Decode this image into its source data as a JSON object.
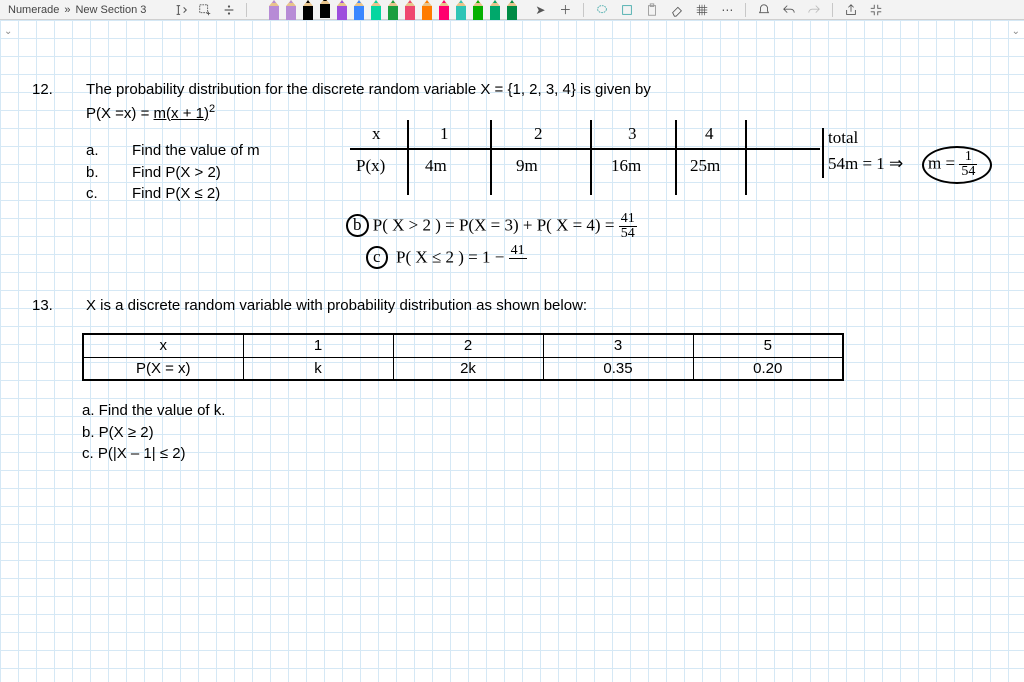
{
  "breadcrumb": {
    "app": "Numerade",
    "sep": "»",
    "section": "New Section 3"
  },
  "pens": [
    {
      "color": "#b78bd6"
    },
    {
      "color": "#b78bd6"
    },
    {
      "color": "#000000"
    },
    {
      "color": "#000000",
      "selected": true
    },
    {
      "color": "#9d4edd"
    },
    {
      "color": "#3a86ff"
    },
    {
      "color": "#06d6a0"
    },
    {
      "color": "#1b9e3f"
    },
    {
      "color": "#ef476f"
    },
    {
      "color": "#ff7b00"
    },
    {
      "color": "#ff006e"
    },
    {
      "color": "#2ec4b6"
    },
    {
      "color": "#06b000"
    },
    {
      "color": "#00a86b"
    },
    {
      "color": "#008b45"
    }
  ],
  "q12": {
    "num": "12.",
    "text": "The probability distribution for the discrete random variable X = {1, 2, 3, 4} is given by",
    "formula_lead": "P(X =x) = ",
    "formula_u": "m(x + 1)",
    "formula_sup": "2",
    "a": {
      "l": "a.",
      "t": "Find the value of m"
    },
    "b": {
      "l": "b.",
      "t": "Find P(X > 2)"
    },
    "c": {
      "l": "c.",
      "t": "Find P(X ≤ 2)"
    }
  },
  "q13": {
    "num": "13.",
    "intro": "X is a discrete random variable with probability distribution as shown below:",
    "rows": {
      "h1": "x",
      "h2": "P(X = x)",
      "c": [
        "1",
        "2",
        "3",
        "5"
      ],
      "p": [
        "k",
        "2k",
        "0.35",
        "0.20"
      ]
    },
    "a": "a.   Find the value of k.",
    "b": "b.   P(X ≥ 2)",
    "c": "c.   P(|X – 1| ≤ 2)"
  },
  "hw": {
    "xrow": {
      "x": "x",
      "vals": [
        "1",
        "2",
        "3",
        "4"
      ]
    },
    "prow": {
      "p": "P(x)",
      "vals": [
        "4m",
        "9m",
        "16m",
        "25m"
      ]
    },
    "total_label": "total",
    "total_eq": "54m = 1 ⇒",
    "m_eq": "m =",
    "m_frac": {
      "n": "1",
      "d": "54"
    },
    "b_label": "b",
    "b_line": "P( X > 2 )  =  P(X = 3) + P( X = 4)  =",
    "b_frac": {
      "n": "41",
      "d": "54"
    },
    "c_label": "c",
    "c_line": "P( X ≤ 2 )  =  1 −",
    "c_frac": {
      "n": "41",
      "d": ""
    }
  }
}
